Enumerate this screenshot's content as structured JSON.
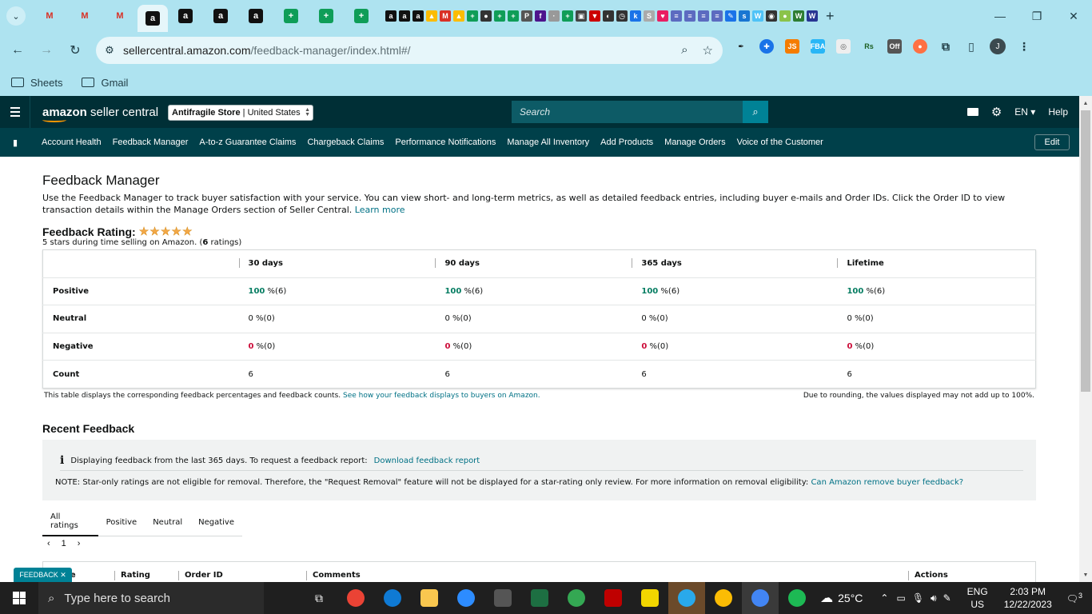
{
  "browser": {
    "url_host": "sellercentral.amazon.com",
    "url_path": "/feedback-manager/index.html#/",
    "bookmarks": [
      "Sheets",
      "Gmail"
    ],
    "profile_initial": "J"
  },
  "header": {
    "logo_brand": "amazon",
    "logo_suffix": "seller central",
    "store_name": "Antifragile Store",
    "store_region": "United States",
    "search_placeholder": "Search",
    "language": "EN",
    "help": "Help"
  },
  "nav": {
    "items": [
      "Account Health",
      "Feedback Manager",
      "A-to-z Guarantee Claims",
      "Chargeback Claims",
      "Performance Notifications",
      "Manage All Inventory",
      "Add Products",
      "Manage Orders",
      "Voice of the Customer"
    ],
    "edit": "Edit"
  },
  "page": {
    "title": "Feedback Manager",
    "intro": "Use the Feedback Manager to track buyer satisfaction with your service. You can view short- and long-term metrics, as well as detailed feedback entries, including buyer e-mails and Order IDs. Click the Order ID to view transaction details within the Manage Orders section of Seller Central.",
    "learn_more": "Learn more",
    "rating_title": "Feedback Rating:",
    "rating_stars": 5,
    "rating_sub_pre": "5 stars during time selling on Amazon. (",
    "rating_count": "6",
    "rating_sub_post": " ratings)"
  },
  "feedback_table": {
    "columns": [
      "30 days",
      "90 days",
      "365 days",
      "Lifetime"
    ],
    "rows": [
      {
        "label": "Positive",
        "pct": "100",
        "count": " %(6)"
      },
      {
        "label": "Neutral",
        "pct": "0",
        "count": " %(0)"
      },
      {
        "label": "Negative",
        "pct": "0",
        "count": " %(0)"
      },
      {
        "label": "Count",
        "value": "6"
      }
    ],
    "note": "This table displays the corresponding feedback percentages and feedback counts.",
    "note_link": "See how your feedback displays to buyers on Amazon.",
    "note_right": "Due to rounding, the values displayed may not add up to 100%."
  },
  "recent": {
    "title": "Recent Feedback",
    "info_text": "Displaying feedback from the last 365 days. To request a feedback report:",
    "info_link": "Download feedback report",
    "note_text": "NOTE: Star-only ratings are not eligible for removal. Therefore, the \"Request Removal\" feature will not be displayed for a star-rating only review. For more information on removal eligibility:",
    "note_link": "Can Amazon remove buyer feedback?",
    "tabs": [
      "All ratings",
      "Positive",
      "Neutral",
      "Negative"
    ],
    "page_number": "1",
    "list_columns": [
      "Date",
      "Rating",
      "Order ID",
      "Comments",
      "Actions"
    ]
  },
  "feedback_widget": "FEEDBACK",
  "taskbar": {
    "search_placeholder": "Type here to search",
    "weather": "25°C",
    "lang_line1": "ENG",
    "lang_line2": "US",
    "time": "2:03 PM",
    "date": "12/22/2023",
    "notifications": "3"
  },
  "colors": {
    "chrome": "#aee3f0",
    "header": "#002f36",
    "nav": "#00404a",
    "link": "#007185",
    "positive": "#067d62",
    "negative": "#cc0c39",
    "star": "#f3a847"
  }
}
